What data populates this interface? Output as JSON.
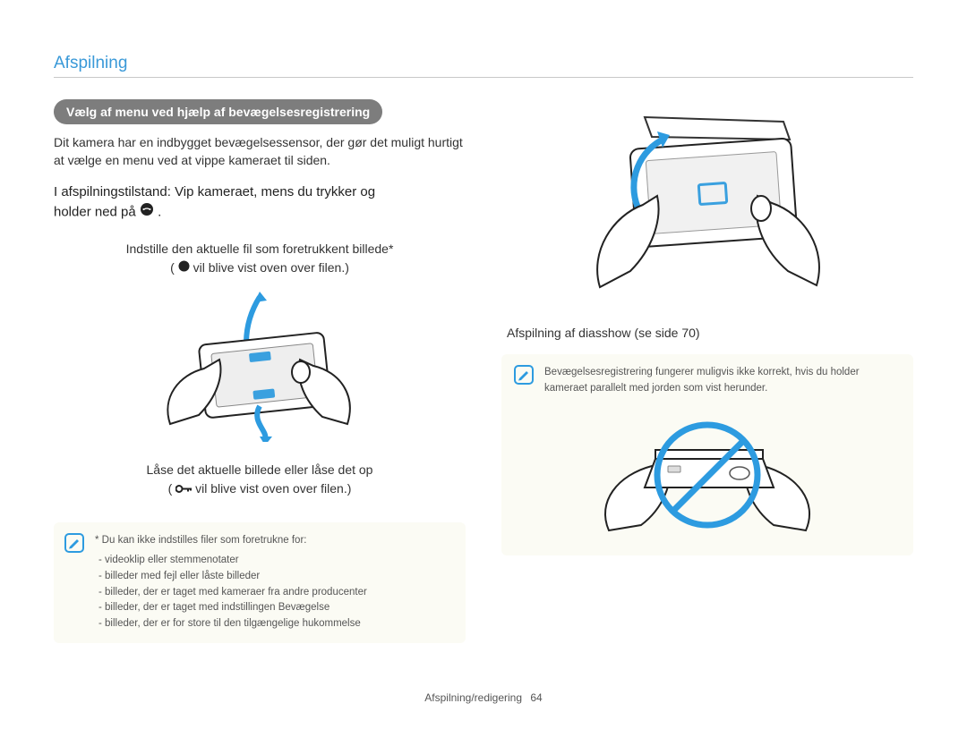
{
  "section_title": "Afspilning",
  "left": {
    "pill": "Vælg af menu ved hjælp af bevægelsesregistrering",
    "intro": "Dit kamera har en indbygget bevægelsessensor, der gør det muligt hurtigt at vælge en menu ved at vippe kameraet til siden.",
    "instr_line1": "I afspilningstilstand: Vip kameraet, mens du trykker og",
    "instr_line2_prefix": "holder ned på ",
    "instr_line2_suffix": ".",
    "set_fav_line1": "Indstille den aktuelle fil som foretrukkent billede*",
    "set_fav_line2_prefix": "(",
    "set_fav_line2_mid": " vil blive vist oven over filen.)",
    "lock_line1": "Låse det aktuelle billede eller låse det op",
    "lock_line2_prefix": "( ",
    "lock_line2_mid": " vil blive vist oven over filen.)",
    "note": {
      "lead": "* Du kan ikke indstilles filer som foretrukne for:",
      "items": [
        "-   videoklip eller stemmenotater",
        "-   billeder med fejl eller låste billeder",
        "-   billeder, der er taget med kameraer fra andre producenter",
        "-   billeder, der er taget med indstillingen Bevægelse",
        "-   billeder, der er for store til den tilgængelige hukommelse"
      ]
    }
  },
  "right": {
    "caption": "Afspilning af diasshow (se side 70)",
    "warn": "Bevægelsesregistrering fungerer muligvis ikke korrekt, hvis du holder kameraet parallelt med jorden som vist herunder."
  },
  "footer": {
    "text": "Afspilning/redigering",
    "page": "64"
  }
}
